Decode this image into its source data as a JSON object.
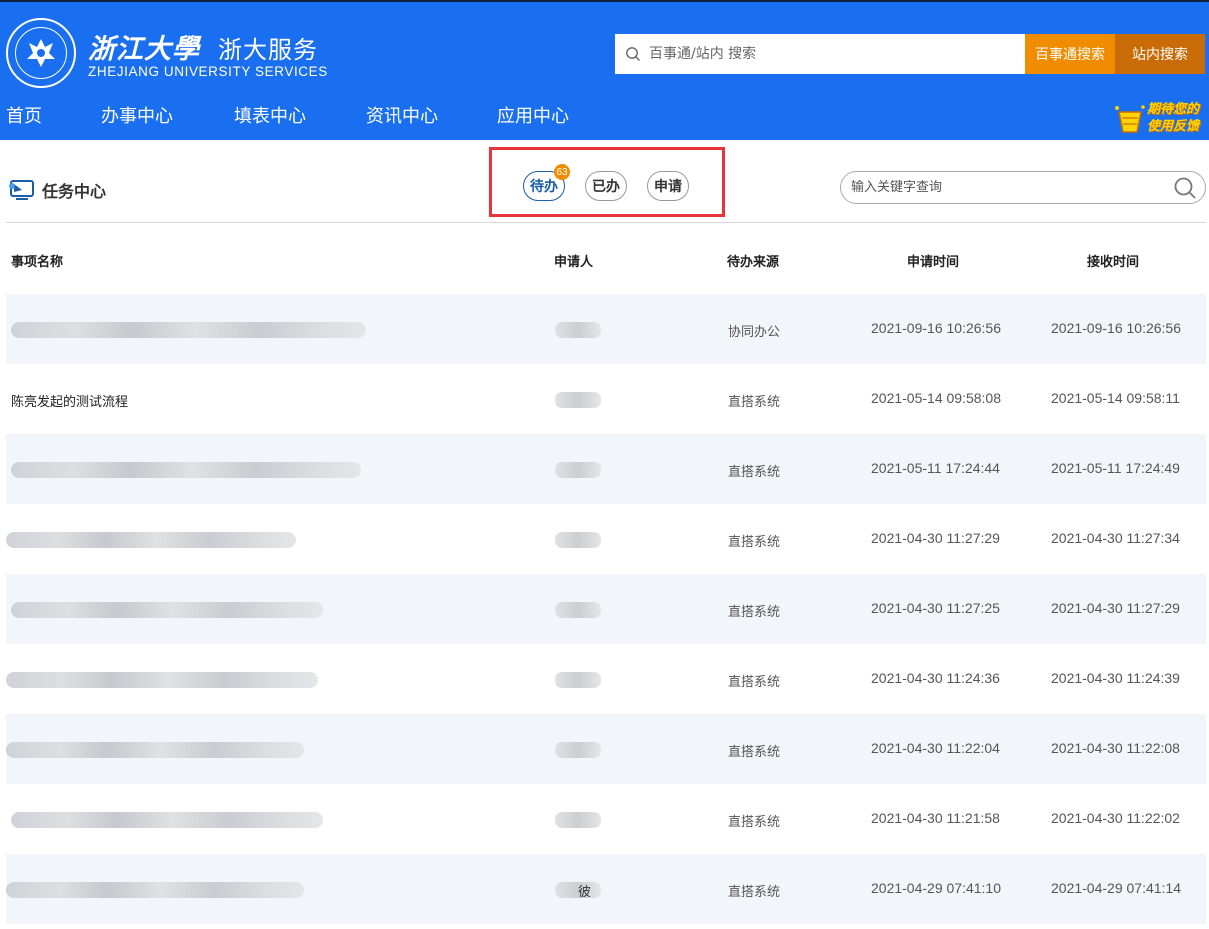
{
  "header": {
    "brand_cn_calligraphy": "浙江大學",
    "brand_service": "浙大服务",
    "brand_en": "ZHEJIANG UNIVERSITY SERVICES",
    "search_placeholder": "百事通/站内 搜索",
    "btn_baishitong": "百事通搜索",
    "btn_site": "站内搜索",
    "feedback_line1": "期待您的",
    "feedback_line2": "使用反馈"
  },
  "nav": [
    "首页",
    "办事中心",
    "填表中心",
    "资讯中心",
    "应用中心"
  ],
  "task": {
    "title": "任务中心",
    "tabs": [
      "待办",
      "已办",
      "申请"
    ],
    "badge": "63",
    "keyword_placeholder": "输入关键字查询"
  },
  "table": {
    "headers": [
      "事项名称",
      "申请人",
      "待办来源",
      "申请时间",
      "接收时间"
    ],
    "rows": [
      {
        "name": "",
        "applicant": "",
        "source": "协同办公",
        "apply_time": "2021-09-16 10:26:56",
        "receive_time": "2021-09-16 10:26:56"
      },
      {
        "name": "陈亮发起的测试流程",
        "applicant": "",
        "source": "直搭系统",
        "apply_time": "2021-05-14 09:58:08",
        "receive_time": "2021-05-14 09:58:11"
      },
      {
        "name": "",
        "applicant": "",
        "source": "直搭系统",
        "apply_time": "2021-05-11 17:24:44",
        "receive_time": "2021-05-11 17:24:49"
      },
      {
        "name": "",
        "applicant": "",
        "source": "直搭系统",
        "apply_time": "2021-04-30 11:27:29",
        "receive_time": "2021-04-30 11:27:34"
      },
      {
        "name": "",
        "applicant": "",
        "source": "直搭系统",
        "apply_time": "2021-04-30 11:27:25",
        "receive_time": "2021-04-30 11:27:29"
      },
      {
        "name": "",
        "applicant": "",
        "source": "直搭系统",
        "apply_time": "2021-04-30 11:24:36",
        "receive_time": "2021-04-30 11:24:39"
      },
      {
        "name": "",
        "applicant": "",
        "source": "直搭系统",
        "apply_time": "2021-04-30 11:22:04",
        "receive_time": "2021-04-30 11:22:08"
      },
      {
        "name": "",
        "applicant": "",
        "source": "直搭系统",
        "apply_time": "2021-04-30 11:21:58",
        "receive_time": "2021-04-30 11:22:02"
      },
      {
        "name": "",
        "applicant": "彼",
        "source": "直搭系统",
        "apply_time": "2021-04-29 07:41:10",
        "receive_time": "2021-04-29 07:41:14"
      }
    ]
  },
  "colors": {
    "header_blue": "#1a6ff0",
    "btn_orange": "#f08c00",
    "btn_dark_orange": "#c96b06",
    "highlight_red": "#e8333a",
    "active_tab_blue": "#1a5ea8"
  },
  "icons": [
    "search-icon",
    "seal-logo",
    "feedback-icon",
    "task-center-icon"
  ]
}
